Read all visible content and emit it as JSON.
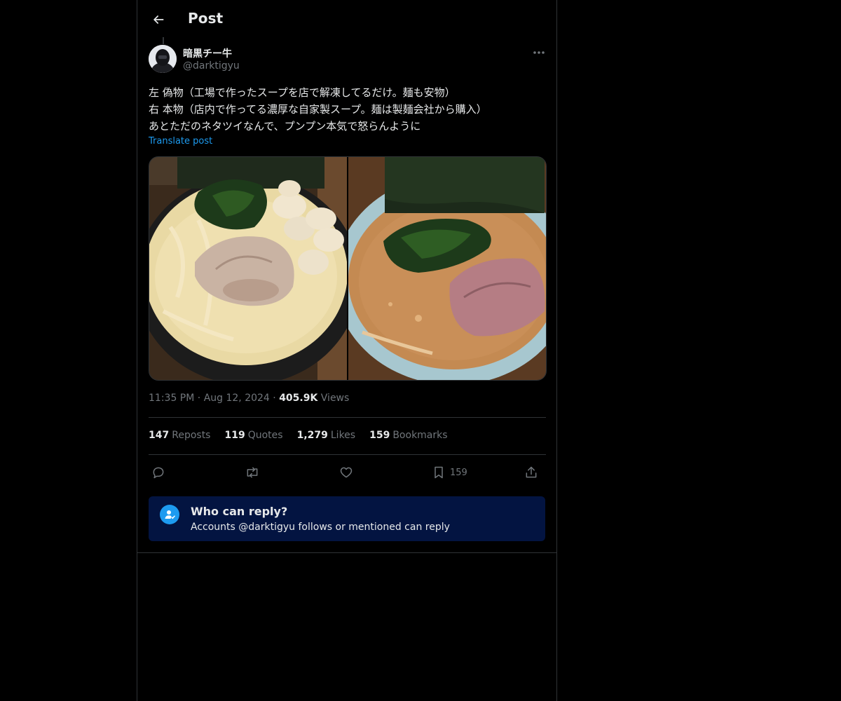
{
  "header": {
    "title": "Post"
  },
  "author": {
    "display_name": "暗黒チー牛",
    "handle": "@darktigyu"
  },
  "post": {
    "text": "左 偽物（工場で作ったスープを店で解凍してるだけ。麺も安物）\n右 本物（店内で作ってる濃厚な自家製スープ。麺は製麺会社から購入）\nあとただのネタツイなんで、プンプン本気で怒らんように",
    "translate_label": "Translate post",
    "time": "11:35 PM",
    "date": "Aug 12, 2024",
    "separator": "·",
    "views_count": "405.9K",
    "views_label": "Views"
  },
  "stats": {
    "reposts_count": "147",
    "reposts_label": "Reposts",
    "quotes_count": "119",
    "quotes_label": "Quotes",
    "likes_count": "1,279",
    "likes_label": "Likes",
    "bookmarks_count": "159",
    "bookmarks_label": "Bookmarks"
  },
  "actions": {
    "bookmark_count": "159"
  },
  "reply_notice": {
    "title": "Who can reply?",
    "subtitle": "Accounts @darktigyu follows or mentioned can reply"
  },
  "icons": [
    "back-arrow-icon",
    "more-icon",
    "reply-icon",
    "repost-icon",
    "like-icon",
    "bookmark-icon",
    "share-icon",
    "mention-user-icon"
  ],
  "colors": {
    "background": "#000000",
    "accent": "#1d9bf0",
    "notice_background": "#031441",
    "muted_text": "#71767b"
  }
}
